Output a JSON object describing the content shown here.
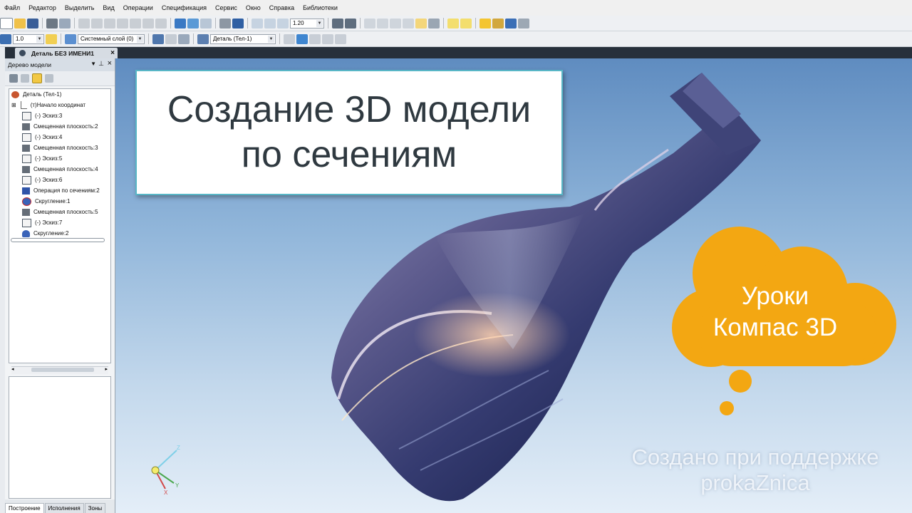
{
  "menu": [
    "Файл",
    "Редактор",
    "Выделить",
    "Вид",
    "Операции",
    "Спецификация",
    "Сервис",
    "Окно",
    "Справка",
    "Библиотеки"
  ],
  "toolbar": {
    "zoom_value": "1.20",
    "step_value": "1.0",
    "layer_value": "Системный слой (0)",
    "body_value": "Деталь (Тел-1)"
  },
  "document_tab": {
    "label": "Деталь БЕЗ ИМЕНИ1",
    "close": "×"
  },
  "panel": {
    "title": "Дерево модели",
    "tree": [
      {
        "label": "Деталь (Тел-1)",
        "icon": "part-icon"
      },
      {
        "label": "(т)Начало координат",
        "icon": "origin-icon"
      },
      {
        "label": "(-) Эскиз:3",
        "icon": "sketch-icon"
      },
      {
        "label": "Смещенная плоскость:2",
        "icon": "plane-icon"
      },
      {
        "label": "(-) Эскиз:4",
        "icon": "sketch-icon"
      },
      {
        "label": "Смещенная плоскость:3",
        "icon": "plane-icon"
      },
      {
        "label": "(-) Эскиз:5",
        "icon": "sketch-icon"
      },
      {
        "label": "Смещенная плоскость:4",
        "icon": "plane-icon"
      },
      {
        "label": "(-) Эскиз:6",
        "icon": "sketch-icon"
      },
      {
        "label": "Операция по сечениям:2",
        "icon": "loft-icon"
      },
      {
        "label": "Скругление:1",
        "icon": "fillet-icon"
      },
      {
        "label": "Смещенная плоскость:5",
        "icon": "plane-icon"
      },
      {
        "label": "(-) Эскиз:7",
        "icon": "sketch-icon"
      },
      {
        "label": "Скругление:2",
        "icon": "fillet-icon"
      }
    ],
    "tabs": [
      "Построение",
      "Исполнения",
      "Зоны"
    ]
  },
  "title_card": {
    "line1": "Создание 3D модели",
    "line2": "по сечениям"
  },
  "cloud": {
    "line1": "Уроки",
    "line2": "Компас 3D"
  },
  "support": {
    "line1": "Создано при поддержке",
    "line2": "prokaZniса"
  },
  "axes": {
    "z": "Z",
    "y": "Y",
    "x": "X"
  },
  "colors": {
    "cloud": "#f3a712",
    "bottle_top": "#4c4f86",
    "bottle_dark": "#1b2248",
    "card_border": "#58b6c6"
  }
}
